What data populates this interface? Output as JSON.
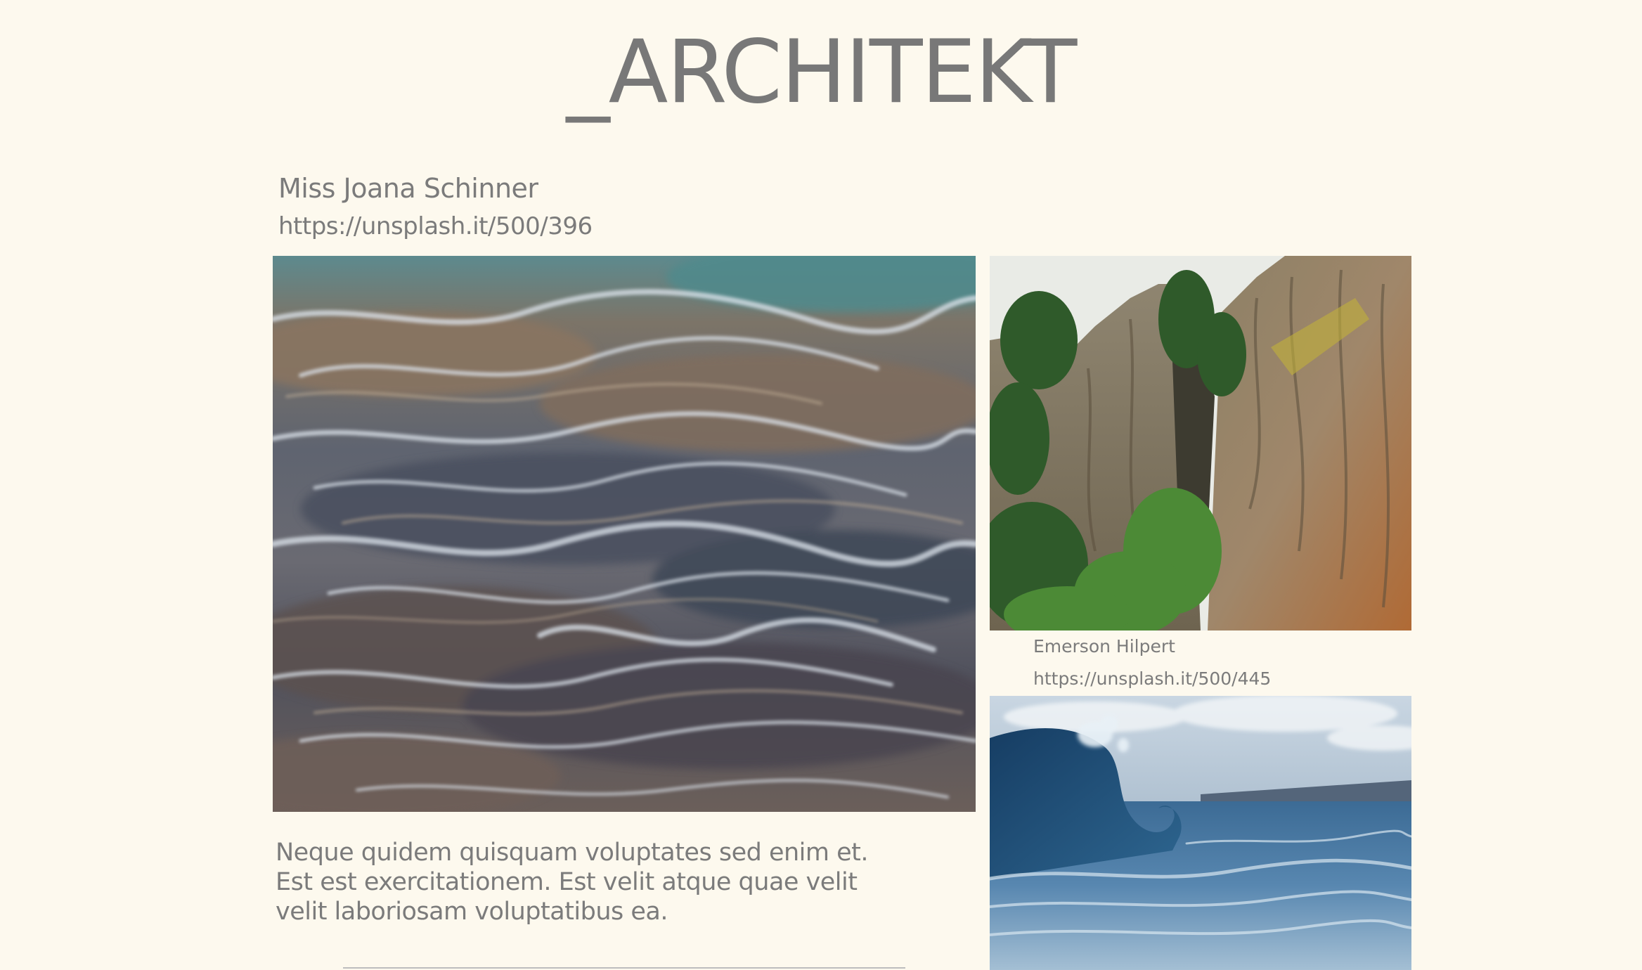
{
  "site": {
    "title": "_ARCHITEKT"
  },
  "featured_post": {
    "author": "Miss Joana Schinner",
    "image_url": "https://unsplash.it/500/396",
    "image_icon": "water-ripple-photo",
    "text": "Neque quidem quisquam voluptates sed enim et. Est est exercitationem. Est velit atque quae velit velit laboriosam voluptatibus ea."
  },
  "side_posts": [
    {
      "image_icon": "rock-cliffs-photo",
      "author": "Emerson Hilpert",
      "image_url": "https://unsplash.it/500/445"
    },
    {
      "image_icon": "ocean-wave-photo"
    }
  ],
  "colors": {
    "background": "#fdf9ee",
    "text": "#7a7a7a"
  }
}
